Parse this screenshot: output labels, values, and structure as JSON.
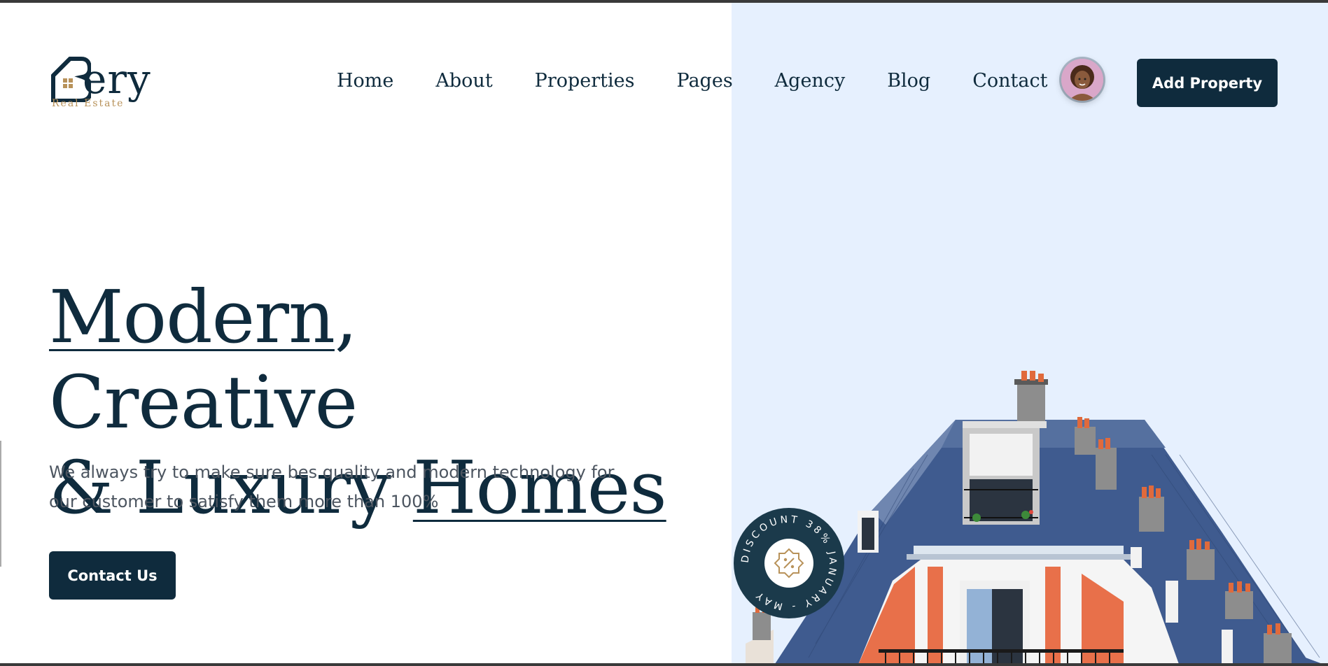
{
  "brand": {
    "name": "ery",
    "initial": "B",
    "tagline": "Real Estate"
  },
  "nav": {
    "items": [
      "Home",
      "About",
      "Properties",
      "Pages",
      "Agency",
      "Blog",
      "Contact"
    ],
    "cta_label": "Add Property"
  },
  "hero": {
    "title_line1_a": "Modern",
    "title_line1_b": ", Creative",
    "title_line2_a": "& Luxury ",
    "title_line2_b": "Homes",
    "subtitle": "We always try to make sure bes quality and modern technology for our customer to satisfy them more than 100%",
    "button_label": "Contact Us"
  },
  "badge": {
    "ring_text": "DISCOUNT 38% JANUARY - MAY",
    "icon": "percent-icon"
  },
  "colors": {
    "primary": "#0f2b3d",
    "accent": "#b8925a",
    "panel": "#e6f0fe",
    "text_muted": "#4c5560"
  }
}
